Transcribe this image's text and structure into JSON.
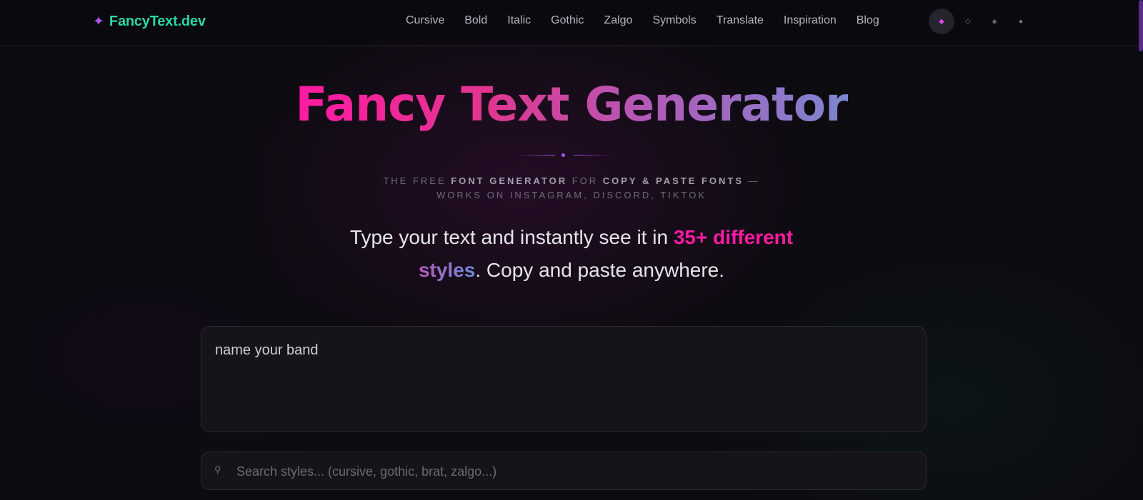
{
  "brand": {
    "icon": "sparkle-icon",
    "name": "FancyText.dev"
  },
  "nav": {
    "links": [
      "Cursive",
      "Bold",
      "Italic",
      "Gothic",
      "Zalgo",
      "Symbols",
      "Translate",
      "Inspiration",
      "Blog"
    ]
  },
  "theme_switcher": {
    "options": [
      "◆",
      "◇",
      "◈",
      "●"
    ],
    "active_index": 0
  },
  "hero": {
    "title": "Fancy Text Generator",
    "tagline": {
      "t1": "THE FREE ",
      "b1": "FONT GENERATOR",
      "t2": " FOR ",
      "b2": "COPY & PASTE FONTS",
      "t3": " —",
      "line2": "WORKS ON INSTAGRAM, DISCORD, TIKTOK"
    },
    "lead": {
      "p1": "Type your text and instantly see it in ",
      "h1": "35+ different",
      "h2": "styles",
      "p2": ". Copy and paste anywhere."
    }
  },
  "input": {
    "value": "name your band"
  },
  "search": {
    "icon": "pin-icon",
    "placeholder": "Search styles... (cursive, gothic, brat, zalgo...)"
  },
  "colors": {
    "brand_green": "#2dd4a7",
    "accent_pink": "#ff1aa3",
    "accent_purple": "#a855f7",
    "accent_blue": "#7b86d0"
  }
}
